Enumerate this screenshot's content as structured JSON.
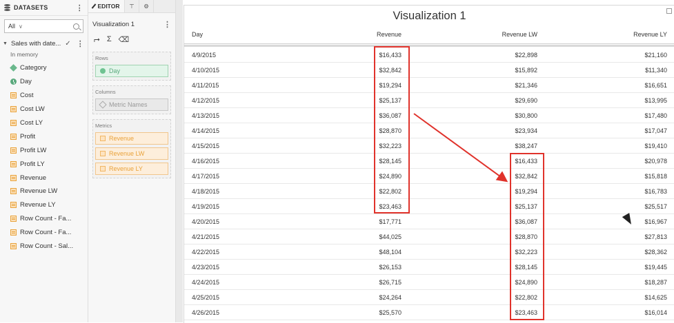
{
  "datasets_panel": {
    "header": "DATASETS",
    "filter": {
      "value": "All"
    },
    "dataset": {
      "name": "Sales with date...",
      "status": "In memory"
    },
    "fields": [
      {
        "label": "Category",
        "icon": "attribute-icon"
      },
      {
        "label": "Day",
        "icon": "time-attribute-icon"
      },
      {
        "label": "Cost",
        "icon": "metric-icon"
      },
      {
        "label": "Cost LW",
        "icon": "metric-icon"
      },
      {
        "label": "Cost LY",
        "icon": "metric-icon"
      },
      {
        "label": "Profit",
        "icon": "metric-icon"
      },
      {
        "label": "Profit LW",
        "icon": "metric-icon"
      },
      {
        "label": "Profit LY",
        "icon": "metric-icon"
      },
      {
        "label": "Revenue",
        "icon": "metric-icon"
      },
      {
        "label": "Revenue LW",
        "icon": "metric-icon"
      },
      {
        "label": "Revenue LY",
        "icon": "metric-icon"
      },
      {
        "label": "Row Count - Fa...",
        "icon": "metric-icon"
      },
      {
        "label": "Row Count - Fa...",
        "icon": "metric-icon"
      },
      {
        "label": "Row Count - Sal...",
        "icon": "metric-icon"
      }
    ]
  },
  "editor_panel": {
    "tabs": {
      "editor": "EDITOR"
    },
    "viz_name": "Visualization 1",
    "rows_label": "Rows",
    "rows": [
      "Day"
    ],
    "columns_label": "Columns",
    "columns": [
      "Metric Names"
    ],
    "metrics_label": "Metrics",
    "metrics": [
      "Revenue",
      "Revenue LW",
      "Revenue LY"
    ]
  },
  "visualization": {
    "title": "Visualization 1",
    "columns": [
      "Day",
      "Revenue",
      "Revenue LW",
      "Revenue LY"
    ],
    "rows": [
      [
        "4/9/2015",
        "$16,433",
        "$22,898",
        "$21,160"
      ],
      [
        "4/10/2015",
        "$32,842",
        "$15,892",
        "$11,340"
      ],
      [
        "4/11/2015",
        "$19,294",
        "$21,346",
        "$16,651"
      ],
      [
        "4/12/2015",
        "$25,137",
        "$29,690",
        "$13,995"
      ],
      [
        "4/13/2015",
        "$36,087",
        "$30,800",
        "$17,480"
      ],
      [
        "4/14/2015",
        "$28,870",
        "$23,934",
        "$17,047"
      ],
      [
        "4/15/2015",
        "$32,223",
        "$38,247",
        "$19,410"
      ],
      [
        "4/16/2015",
        "$28,145",
        "$16,433",
        "$20,978"
      ],
      [
        "4/17/2015",
        "$24,890",
        "$32,842",
        "$15,818"
      ],
      [
        "4/18/2015",
        "$22,802",
        "$19,294",
        "$16,783"
      ],
      [
        "4/19/2015",
        "$23,463",
        "$25,137",
        "$25,517"
      ],
      [
        "4/20/2015",
        "$17,771",
        "$36,087",
        "$16,967"
      ],
      [
        "4/21/2015",
        "$44,025",
        "$28,870",
        "$27,813"
      ],
      [
        "4/22/2015",
        "$48,104",
        "$32,223",
        "$28,362"
      ],
      [
        "4/23/2015",
        "$26,153",
        "$28,145",
        "$19,445"
      ],
      [
        "4/24/2015",
        "$26,715",
        "$24,890",
        "$18,287"
      ],
      [
        "4/25/2015",
        "$24,264",
        "$22,802",
        "$14,625"
      ],
      [
        "4/26/2015",
        "$25,570",
        "$23,463",
        "$16,014"
      ]
    ],
    "annotation_color": "#e0322b"
  }
}
